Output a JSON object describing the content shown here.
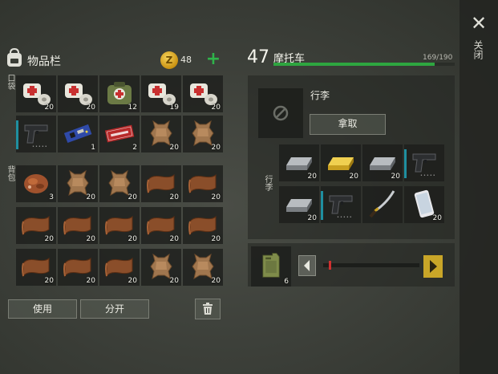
{
  "close_label": "关闭",
  "inventory": {
    "title": "物品栏",
    "coins": "48",
    "pocket_label": "口袋",
    "backpack_label": "背包",
    "use_label": "使用",
    "split_label": "分开",
    "pockets": [
      {
        "icon": "bandage-icon",
        "count": "20"
      },
      {
        "icon": "bandage-icon",
        "count": "20"
      },
      {
        "icon": "medkit-bag-icon",
        "count": "12"
      },
      {
        "icon": "bandage-icon",
        "count": "19"
      },
      {
        "icon": "bandage-icon",
        "count": "20"
      },
      {
        "icon": "pistol-icon",
        "count": ""
      },
      {
        "icon": "circuit-board-icon",
        "count": "1"
      },
      {
        "icon": "coupon-ticket-icon",
        "count": "2"
      },
      {
        "icon": "animal-hide-icon",
        "count": "20"
      },
      {
        "icon": "animal-hide-icon",
        "count": "20"
      }
    ],
    "backpack": [
      {
        "icon": "raw-meat-icon",
        "count": "3"
      },
      {
        "icon": "animal-hide-icon",
        "count": "20"
      },
      {
        "icon": "animal-hide-icon",
        "count": "20"
      },
      {
        "icon": "leather-icon",
        "count": "20"
      },
      {
        "icon": "leather-icon",
        "count": "20"
      },
      {
        "icon": "leather-icon",
        "count": "20"
      },
      {
        "icon": "leather-icon",
        "count": "20"
      },
      {
        "icon": "leather-icon",
        "count": "20"
      },
      {
        "icon": "leather-icon",
        "count": "20"
      },
      {
        "icon": "leather-icon",
        "count": "20"
      },
      {
        "icon": "leather-icon",
        "count": "20"
      },
      {
        "icon": "leather-icon",
        "count": "20"
      },
      {
        "icon": "leather-icon",
        "count": "20"
      },
      {
        "icon": "animal-hide-icon",
        "count": "20"
      },
      {
        "icon": "animal-hide-icon",
        "count": "20"
      }
    ]
  },
  "vehicle": {
    "level": "47",
    "name": "摩托车",
    "hp_text": "169/190",
    "hp_fraction": 0.889,
    "trunk_label": "行李",
    "trunk_side_label": "行李",
    "take_label": "拿取",
    "trunk_items": [
      {
        "icon": "iron-bar-icon",
        "count": "20"
      },
      {
        "icon": "gold-bar-icon",
        "count": "20"
      },
      {
        "icon": "iron-bar-icon",
        "count": "20"
      },
      {
        "icon": "pistol-icon",
        "count": ""
      },
      {
        "icon": "iron-bar-icon",
        "count": "20"
      },
      {
        "icon": "pistol-icon",
        "count": ""
      },
      {
        "icon": "katana-icon",
        "count": ""
      },
      {
        "icon": "smartphone-icon",
        "count": "20"
      }
    ],
    "fuel_count": "6",
    "fuel_level": 0.03
  },
  "colors": {
    "health": "#2ea640",
    "coin": "#e0b020",
    "plus": "#2fb44a",
    "nav_active": "#c9a628"
  }
}
